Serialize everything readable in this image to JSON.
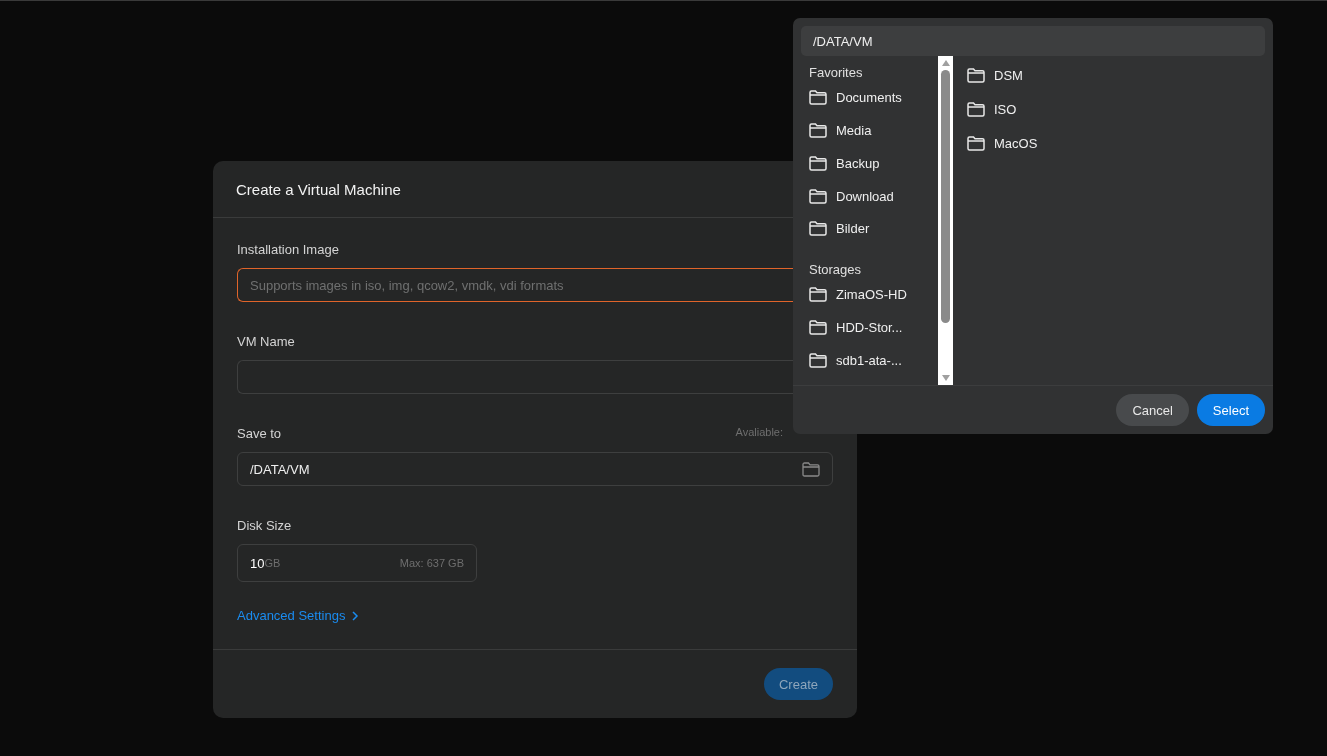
{
  "dialog": {
    "title": "Create a Virtual Machine",
    "installation_image": {
      "label": "Installation Image",
      "placeholder": "Supports images in iso, img, qcow2, vmdk, vdi formats"
    },
    "vm_name": {
      "label": "VM Name"
    },
    "save_to": {
      "label": "Save to",
      "available": "Avaliable:",
      "value": "/DATA/VM"
    },
    "disk_size": {
      "label": "Disk Size",
      "value": "10",
      "unit": "GB",
      "max": "Max: 637 GB"
    },
    "advanced_link": "Advanced Settings",
    "create_button": "Create"
  },
  "file_picker": {
    "path": "/DATA/VM",
    "sections": [
      {
        "title": "Favorites",
        "items": [
          "Documents",
          "Media",
          "Backup",
          "Download",
          "Bilder"
        ]
      },
      {
        "title": "Storages",
        "items": [
          "ZimaOS-HD",
          "HDD-Stor...",
          "sdb1-ata-..."
        ]
      }
    ],
    "folders": [
      "DSM",
      "ISO",
      "MacOS"
    ],
    "buttons": {
      "cancel": "Cancel",
      "select": "Select"
    }
  }
}
